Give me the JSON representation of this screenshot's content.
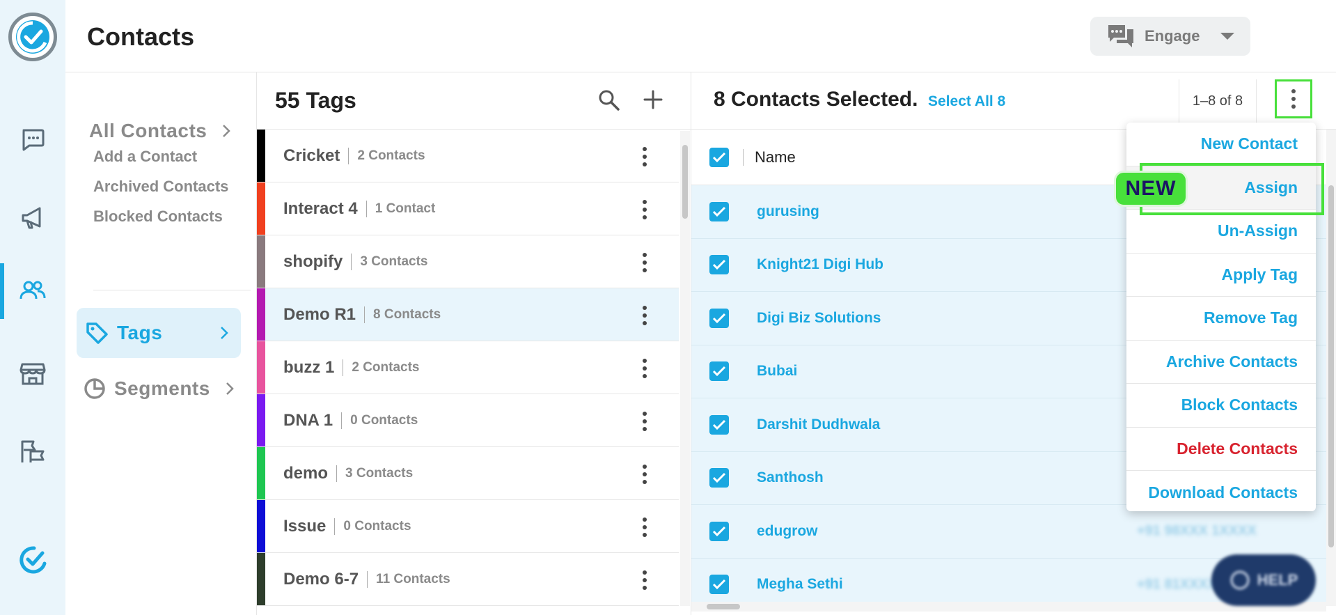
{
  "header": {
    "title": "Contacts",
    "engage_label": "Engage"
  },
  "rail": {
    "items": [
      "chat-icon",
      "megaphone-icon",
      "contacts-icon",
      "store-icon",
      "flags-icon"
    ],
    "active": "contacts-icon",
    "accent": "#1aa7e0"
  },
  "subnav": {
    "all_contacts": "All Contacts",
    "links": [
      "Add a Contact",
      "Archived Contacts",
      "Blocked Contacts"
    ],
    "tags": "Tags",
    "segments": "Segments"
  },
  "tags": {
    "title": "55 Tags",
    "list": [
      {
        "name": "Cricket",
        "count": "2 Contacts",
        "color": "#000000"
      },
      {
        "name": "Interact 4",
        "count": "1 Contact",
        "color": "#f0401f"
      },
      {
        "name": "shopify",
        "count": "3 Contacts",
        "color": "#8a7a7e"
      },
      {
        "name": "Demo R1",
        "count": "8 Contacts",
        "color": "#b41ab0",
        "selected": true
      },
      {
        "name": "buzz 1",
        "count": "2 Contacts",
        "color": "#e8549e"
      },
      {
        "name": "DNA 1",
        "count": "0 Contacts",
        "color": "#7a1af0"
      },
      {
        "name": "demo",
        "count": "3 Contacts",
        "color": "#1ec651"
      },
      {
        "name": "Issue",
        "count": "0 Contacts",
        "color": "#0e0ed6"
      },
      {
        "name": "Demo 6-7",
        "count": "11 Contacts",
        "color": "#2e3e2c"
      }
    ]
  },
  "contacts": {
    "selected_title": "8 Contacts Selected.",
    "select_all": "Select All 8",
    "pagination": "1–8 of 8",
    "column_name": "Name",
    "rows": [
      {
        "name": "gurusing"
      },
      {
        "name": "Knight21 Digi Hub"
      },
      {
        "name": "Digi Biz Solutions"
      },
      {
        "name": "Bubai"
      },
      {
        "name": "Darshit Dudhwala"
      },
      {
        "name": "Santhosh"
      },
      {
        "name": "edugrow",
        "phone": "+91 98XXX 1XXXX"
      },
      {
        "name": "Megha Sethi",
        "phone": "+91 81XXXXXX"
      }
    ]
  },
  "menu": {
    "items": [
      {
        "label": "New Contact"
      },
      {
        "label": "Assign",
        "highlighted": true
      },
      {
        "label": "Un-Assign"
      },
      {
        "label": "Apply Tag"
      },
      {
        "label": "Remove Tag"
      },
      {
        "label": "Archive Contacts"
      },
      {
        "label": "Block Contacts"
      },
      {
        "label": "Delete Contacts",
        "danger": true
      },
      {
        "label": "Download Contacts"
      }
    ],
    "new_badge": "NEW",
    "highlight_color": "#48e03b"
  },
  "help": {
    "label": "HELP"
  }
}
